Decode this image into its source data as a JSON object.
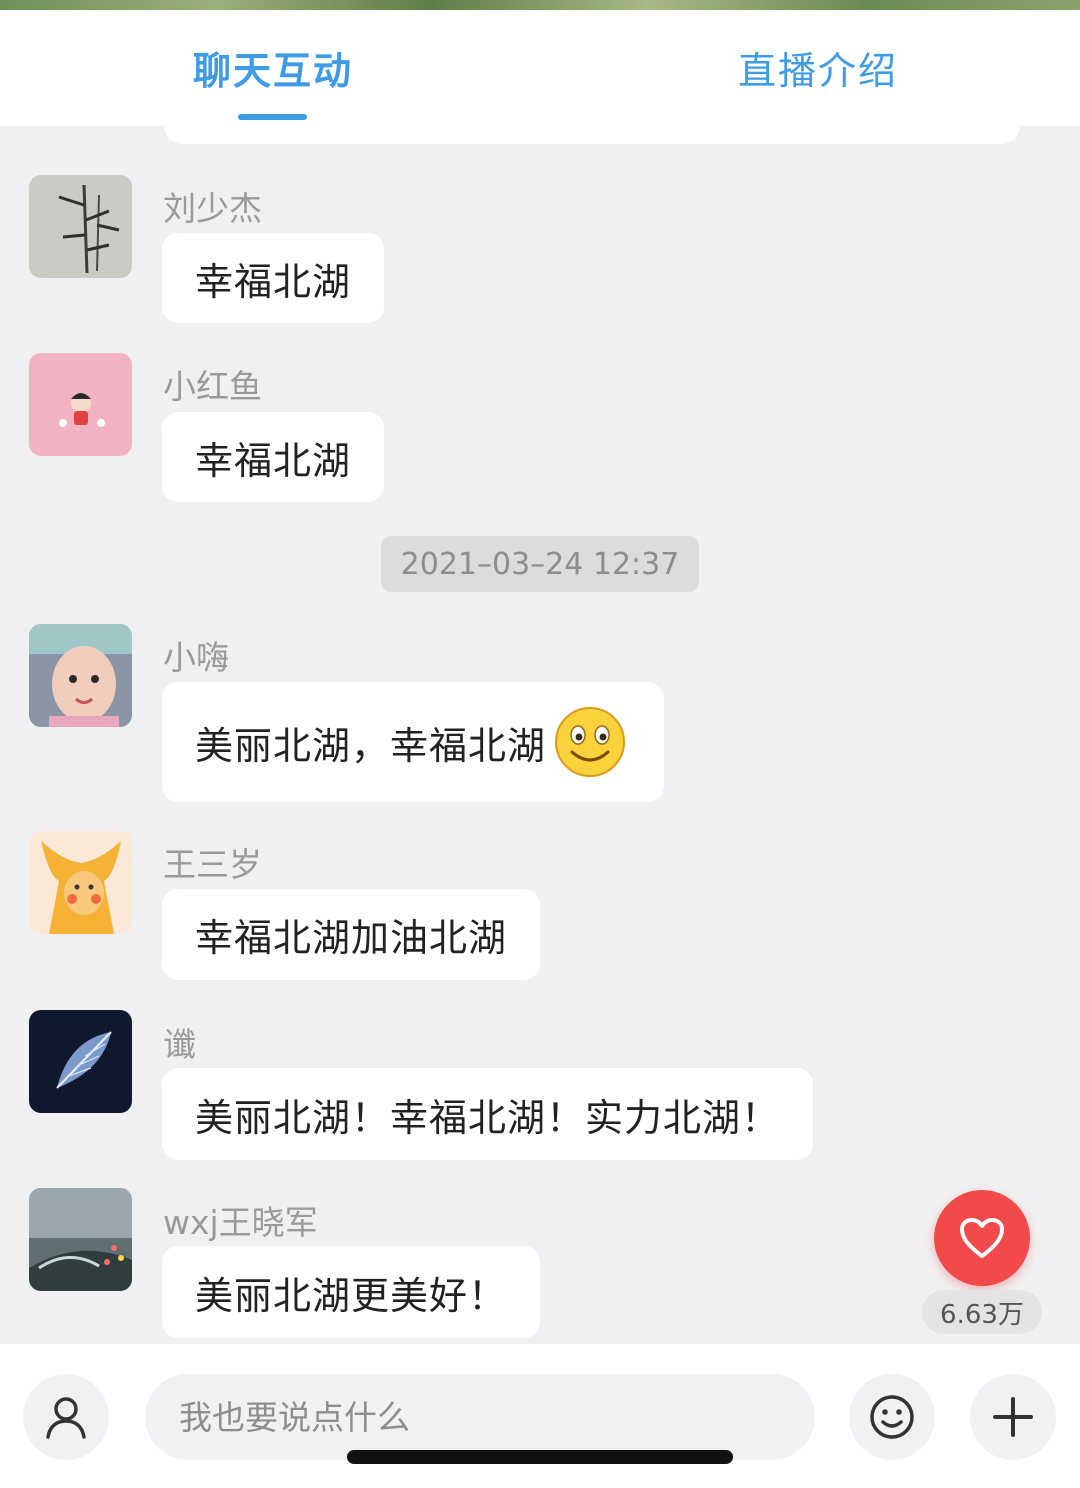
{
  "tabs": [
    {
      "label": "聊天互动",
      "active": true
    },
    {
      "label": "直播介绍",
      "active": false
    }
  ],
  "messages": [
    {
      "user": "刘少杰",
      "text": "幸福北湖",
      "avatar": "bamboo-painting"
    },
    {
      "user": "小红鱼",
      "text": "幸福北湖",
      "avatar": "cartoon-girl"
    },
    {
      "user": "小嗨",
      "text": "美丽北湖，幸福北湖",
      "emoji": "smiley-emoji",
      "avatar": "child-photo"
    },
    {
      "user": "王三岁",
      "text": "幸福北湖加油北湖",
      "avatar": "orange-cartoon"
    },
    {
      "user": "谶",
      "text": "美丽北湖！幸福北湖！实力北湖！",
      "avatar": "blue-feather"
    },
    {
      "user": "wxj王晓军",
      "text": "美丽北湖更美好！",
      "avatar": "night-bridge"
    }
  ],
  "timestamp": "2021–03–24 12:37",
  "like": {
    "count": "6.63万",
    "icon": "heart-icon",
    "color": "#f24a4a"
  },
  "composer": {
    "placeholder": "我也要说点什么",
    "profile_icon": "person-icon",
    "emoji_icon": "smiley-icon",
    "plus_icon": "plus-icon"
  },
  "colors": {
    "accent": "#3e9ce6",
    "background": "#f0f0f2"
  }
}
